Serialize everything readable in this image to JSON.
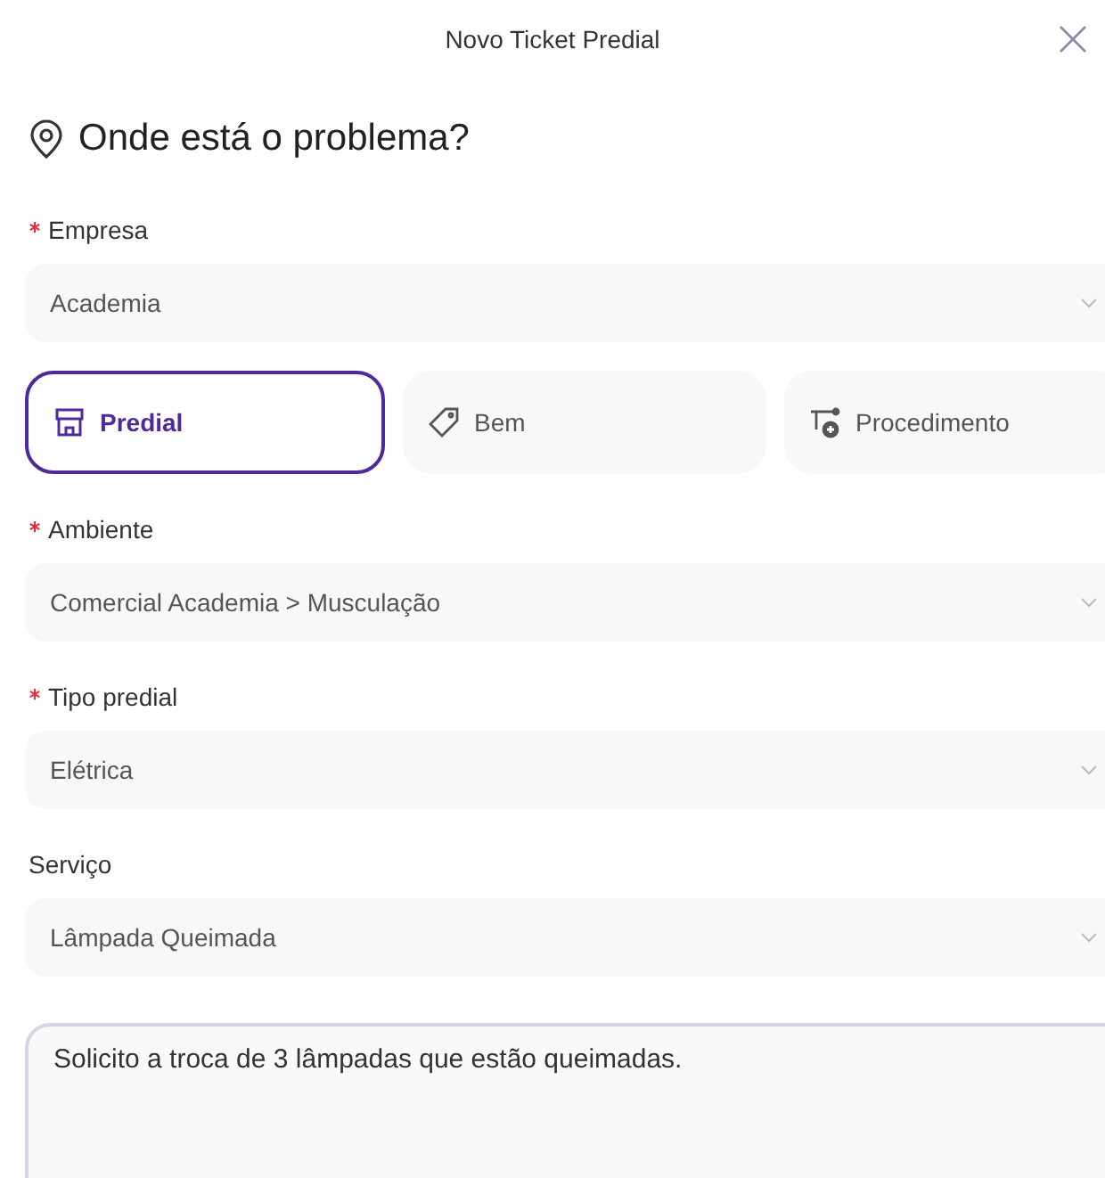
{
  "dialog": {
    "title": "Novo Ticket Predial"
  },
  "section": {
    "title": "Onde está o problema?"
  },
  "fields_top": [
    {
      "label": "Empresa",
      "required": true,
      "value": "Academia"
    }
  ],
  "tabs": [
    {
      "label": "Predial",
      "kind": "store",
      "selected": true
    },
    {
      "label": "Bem",
      "kind": "tag",
      "selected": false
    },
    {
      "label": "Procedimento",
      "kind": "route",
      "selected": false
    }
  ],
  "fields": [
    {
      "label": "Ambiente",
      "required": true,
      "value": "Comercial Academia > Musculação"
    },
    {
      "label": "Tipo predial",
      "required": true,
      "value": "Elétrica"
    },
    {
      "label": "Serviço",
      "required": false,
      "value": "Lâmpada Queimada"
    }
  ],
  "description": {
    "value": "Solicito a troca de 3 lâmpadas que estão queimadas."
  }
}
